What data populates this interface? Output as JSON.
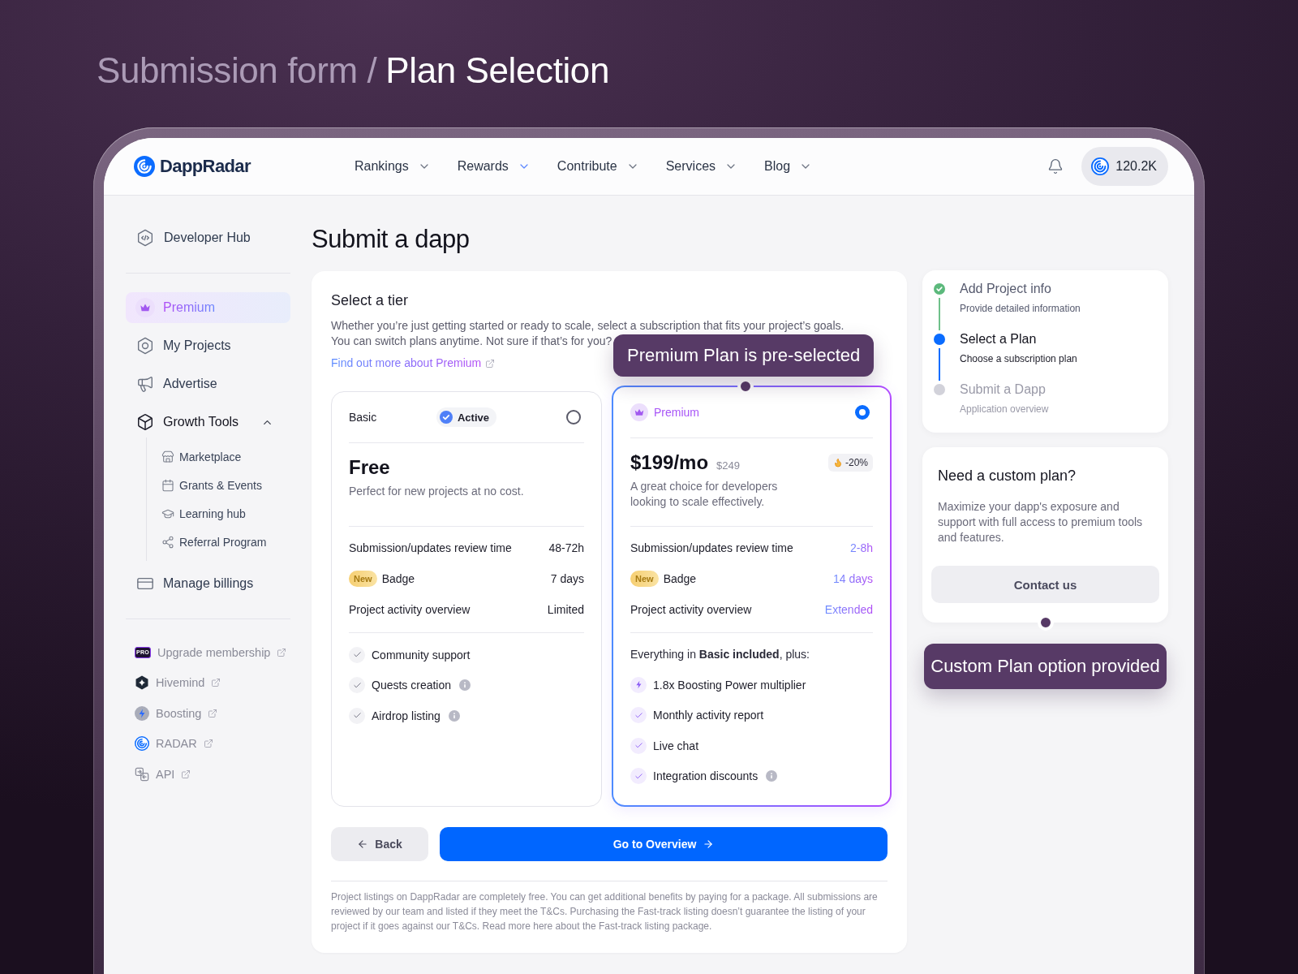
{
  "heading": {
    "section": "Submission form /",
    "title": "Plan Selection"
  },
  "header": {
    "brand": "DappRadar",
    "nav": [
      {
        "label": "Rankings",
        "active": false
      },
      {
        "label": "Rewards",
        "active": true
      },
      {
        "label": "Contribute",
        "active": false
      },
      {
        "label": "Services",
        "active": false
      },
      {
        "label": "Blog",
        "active": false
      }
    ],
    "balance": "120.2K"
  },
  "sidebar": {
    "hub": "Developer Hub",
    "items": [
      {
        "label": "Premium",
        "selected": true
      },
      {
        "label": "My Projects",
        "selected": false
      },
      {
        "label": "Advertise",
        "selected": false
      },
      {
        "label": "Growth Tools",
        "selected": false,
        "expanded": true,
        "children": [
          {
            "label": "Marketplace"
          },
          {
            "label": "Grants & Events"
          },
          {
            "label": "Learning hub"
          },
          {
            "label": "Referral Program"
          }
        ]
      },
      {
        "label": "Manage billings",
        "selected": false
      }
    ],
    "links": [
      {
        "label": "Upgrade membership",
        "badge": "PRO"
      },
      {
        "label": "Hivemind"
      },
      {
        "label": "Boosting"
      },
      {
        "label": "RADAR"
      },
      {
        "label": "API"
      }
    ]
  },
  "page_title": "Submit a dapp",
  "tier_form": {
    "title": "Select a tier",
    "description": "Whether you’re just getting started or ready to scale, select a subscription that fits your project’s goals. You can switch plans anytime. Not sure if that’s for you?",
    "link": "Find out more about Premium",
    "plans": [
      {
        "kind": "basic",
        "name": "Basic",
        "status": "Active",
        "selected": false,
        "price": "Free",
        "description": "Perfect for new projects at no cost.",
        "rows": [
          {
            "label": "Submission/updates review time",
            "value": "48-72h"
          },
          {
            "tag": "New",
            "label": "Badge",
            "value": "7 days"
          },
          {
            "label": "Project activity overview",
            "value": "Limited"
          }
        ],
        "features": [
          {
            "kind": "check",
            "label": "Community support",
            "info": false
          },
          {
            "kind": "check",
            "label": "Quests creation",
            "info": true
          },
          {
            "kind": "check",
            "label": "Airdrop listing",
            "info": true
          }
        ]
      },
      {
        "kind": "premium",
        "name": "Premium",
        "selected": true,
        "price": "$199/mo",
        "old_price": "$249",
        "discount": "-20%",
        "description": "A great choice for developers looking to scale effectively.",
        "rows": [
          {
            "label": "Submission/updates review time",
            "value": "2-8h"
          },
          {
            "tag": "New",
            "label": "Badge",
            "value": "14 days"
          },
          {
            "label": "Project activity overview",
            "value": "Extended"
          }
        ],
        "includes": "Everything in **Basic included**, plus:",
        "features": [
          {
            "kind": "boost",
            "label": "1.8x Boosting Power multiplier",
            "info": false
          },
          {
            "kind": "check",
            "label": "Monthly activity report",
            "info": false
          },
          {
            "kind": "check",
            "label": "Live chat",
            "info": false
          },
          {
            "kind": "check",
            "label": "Integration discounts",
            "info": true
          }
        ]
      }
    ],
    "buttons": {
      "back": "Back",
      "next": "Go to Overview"
    },
    "footnote": "Project listings on DappRadar are completely free. You can get additional benefits by paying for a package. All submissions are reviewed by our team and listed if they meet the T&Cs. Purchasing the Fast-track listing doesn’t guarantee the listing of your project if it goes against our T&Cs. Read more here about the Fast-track listing package."
  },
  "steps": [
    {
      "title": "Add Project info",
      "subtitle": "Provide detailed information",
      "completed": true,
      "selected": false
    },
    {
      "title": "Select a Plan",
      "subtitle": "Choose a subscription plan",
      "completed": false,
      "selected": true
    },
    {
      "title": "Submit a Dapp",
      "subtitle": "Application overview",
      "completed": false,
      "selected": false
    }
  ],
  "custom_plan": {
    "title": "Need a custom plan?",
    "description": "Maximize your dapp's exposure and support with full access to premium tools and features.",
    "button": "Contact us"
  },
  "annotations": [
    {
      "text": "Premium Plan is pre-selected"
    },
    {
      "text": "Custom Plan option provided"
    }
  ]
}
